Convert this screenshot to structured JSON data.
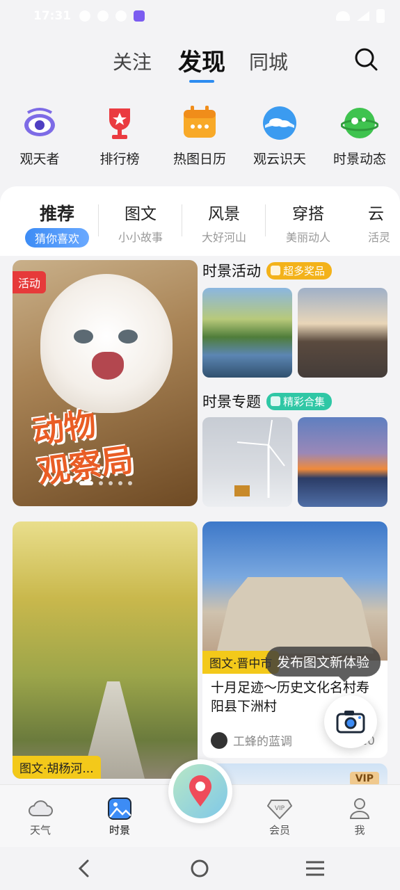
{
  "status_bar": {
    "time": "17:31"
  },
  "top_tabs": [
    {
      "label": "关注",
      "active": false
    },
    {
      "label": "发现",
      "active": true
    },
    {
      "label": "同城",
      "active": false
    }
  ],
  "features": [
    {
      "label": "观天者",
      "icon": "eye-icon",
      "color": "#6b5bd8"
    },
    {
      "label": "排行榜",
      "icon": "trophy-icon",
      "color": "#e8383d"
    },
    {
      "label": "热图日历",
      "icon": "calendar-icon",
      "color": "#f6a623"
    },
    {
      "label": "观云识天",
      "icon": "cloud-icon",
      "color": "#3b9bf0"
    },
    {
      "label": "时景动态",
      "icon": "planet-icon",
      "color": "#3ec24d"
    }
  ],
  "categories": [
    {
      "title": "推荐",
      "subtitle": "猜你喜欢",
      "active": true
    },
    {
      "title": "图文",
      "subtitle": "小小故事",
      "active": false
    },
    {
      "title": "风景",
      "subtitle": "大好河山",
      "active": false
    },
    {
      "title": "穿搭",
      "subtitle": "美丽动人",
      "active": false
    },
    {
      "title": "云",
      "subtitle": "活灵",
      "active": false
    }
  ],
  "banner": {
    "badge": "活动",
    "title_line1": "动物",
    "title_line2": "观察局"
  },
  "activity_section": {
    "title": "时景活动",
    "pill": "超多奖品",
    "pill_color": "#f3b21a"
  },
  "topic_section": {
    "title": "时景专题",
    "pill": "精彩合集",
    "pill_color": "#2fc7a5"
  },
  "feed_left": {
    "tag": "图文·胡杨河..."
  },
  "feed_right": {
    "tag": "图文·晋中市",
    "title": "十月足迹～历史文化名村寿阳县下洲村",
    "author": "工蜂的蓝调",
    "count": "20"
  },
  "tooltip": "发布图文新体验",
  "next_card": {
    "badge": "VIP"
  },
  "bottom_nav": [
    {
      "label": "天气",
      "icon": "cloud-icon",
      "active": false
    },
    {
      "label": "时景",
      "icon": "image-icon",
      "active": true
    },
    {
      "label": "会员",
      "icon": "vip-diamond-icon",
      "active": false
    },
    {
      "label": "我",
      "icon": "profile-icon",
      "active": false
    }
  ],
  "accent_color": "#2d8cf0"
}
